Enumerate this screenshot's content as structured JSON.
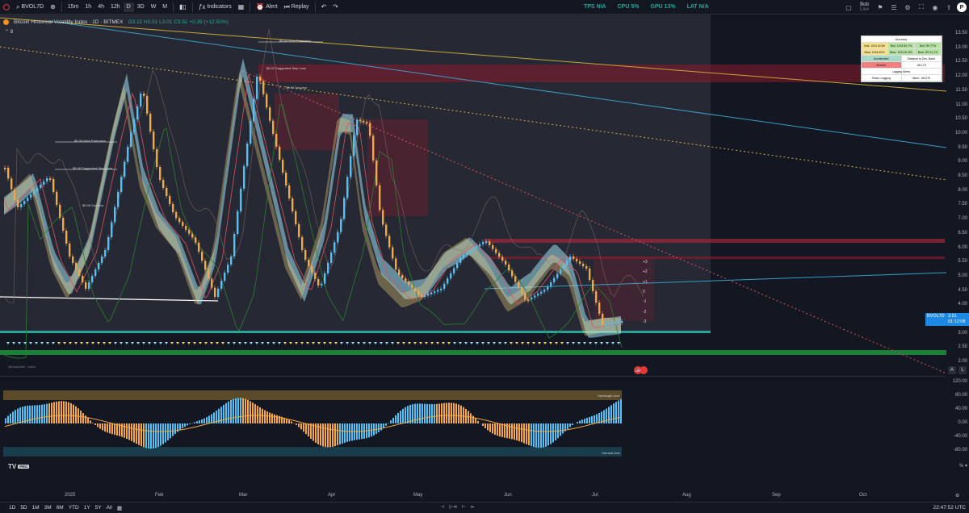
{
  "toolbar": {
    "symbol": "BVOL7D",
    "intervals": [
      "15m",
      "1h",
      "4h",
      "12h",
      "D",
      "3D",
      "W",
      "M"
    ],
    "active_interval": "D",
    "indicators_label": "Indicators",
    "alert_label": "Alert",
    "replay_label": "Replay",
    "stats": [
      "TPS N/A",
      "CPU 5%",
      "GPU 13%",
      "LAT N/A"
    ],
    "user_name": "Bob",
    "user_sub": "Live"
  },
  "legend": {
    "title": "Bitcoin Historical Volatility Index · 1D · BITMEX",
    "ohlc": "O3.12 H3.51 L3.01 C3.51 +0.39 (+12.50%)",
    "collapse_count": "8"
  },
  "price_axis": {
    "ticks": [
      "13.50",
      "13.00",
      "12.50",
      "12.00",
      "11.50",
      "11.00",
      "10.50",
      "10.00",
      "9.50",
      "9.00",
      "8.50",
      "8.00",
      "7.50",
      "7.00",
      "6.50",
      "6.00",
      "5.50",
      "5.00",
      "4.50",
      "4.00",
      "3.50",
      "3.00",
      "2.50",
      "2.00"
    ],
    "symbol_tag": "BVOL7D",
    "symbol_value": "3.51",
    "last_price": "3.51",
    "countdown": "01:12:08"
  },
  "osc_axis": {
    "ticks": [
      "120.00",
      "80.00",
      "40.00",
      "0.00",
      "-40.00",
      "-80.00"
    ],
    "corner": "% ▾"
  },
  "info_table": {
    "rows": [
      [
        "Accuracy"
      ],
      [
        "Bull. 1024 40.89",
        "Bull. 1024 60.7%",
        "Bull. R9 77%"
      ],
      [
        "Bear. 1024 60%",
        "Bear. 1024 81.8%",
        "Bear. R9 91.1%"
      ],
      [
        "Accelerated",
        "Distance to Dev. Band"
      ],
      [
        "Bearish",
        "-68.175"
      ],
      [
        "Lagging Alerts"
      ],
      [
        "Strain: Lagging",
        "Value: -68.075"
      ]
    ]
  },
  "chart_labels": {
    "wick_protection_1": "$5.44 Wick Protection",
    "suggested_stop_1": "$5.31 Suggested Stop Loss",
    "success_1": "$5.44 Success",
    "wick_protection_2": "$5.08 Wick Protection",
    "suggested_stop_2": "$5.08 Suggested Stop Loss",
    "success_2": "$5.08 Success",
    "bands": [
      "+3",
      "+2",
      "+1",
      "0",
      "-1",
      "-2",
      "-3"
    ],
    "overbought": "Overbought Zone",
    "oversold": "Oversold Zone",
    "watermark": "@Daytrader_Gains"
  },
  "time_axis": {
    "labels": [
      "2025",
      "Feb",
      "Mar",
      "Apr",
      "May",
      "Jun",
      "Jul",
      "Aug",
      "Sep",
      "Oct"
    ]
  },
  "bottom_bar": {
    "ranges": [
      "1D",
      "5D",
      "1M",
      "3M",
      "6M",
      "YTD",
      "1Y",
      "5Y",
      "All"
    ],
    "clock": "22:47:52 UTC"
  },
  "logo": {
    "text": "TV",
    "badge": "PRO"
  },
  "colors": {
    "bg": "#131722",
    "bull_candle": "#4fc3f7",
    "bear_candle": "#f5a742",
    "red_zone": "#8b1a2b",
    "ribbon_yellow": "#f2d07a",
    "ribbon_blue": "#9bdcf0",
    "accent_blue": "#1e88e5"
  }
}
